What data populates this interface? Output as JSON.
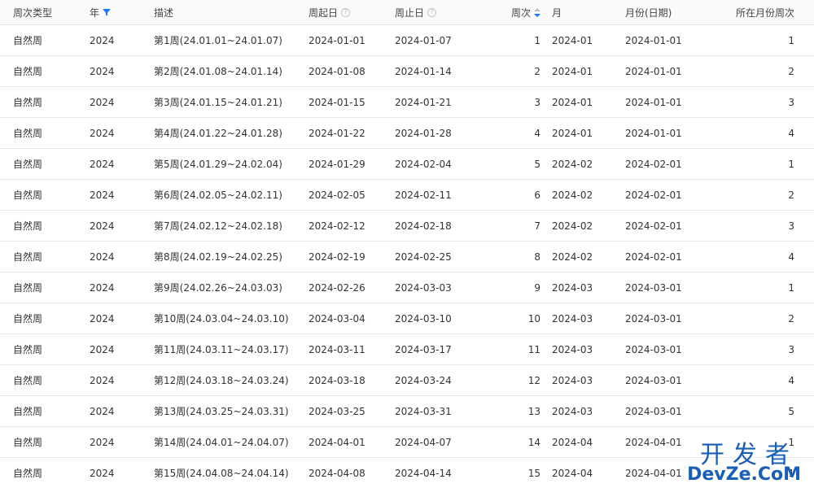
{
  "table": {
    "columns": {
      "week_type": "周次类型",
      "year": "年",
      "description": "描述",
      "start_date": "周起日",
      "end_date": "周止日",
      "week_no": "周次",
      "month": "月",
      "month_date": "月份(日期)",
      "week_in_month": "所在月份周次"
    },
    "rows": [
      {
        "week_type": "自然周",
        "year": "2024",
        "description": "第1周(24.01.01~24.01.07)",
        "start_date": "2024-01-01",
        "end_date": "2024-01-07",
        "week_no": "1",
        "month": "2024-01",
        "month_date": "2024-01-01",
        "week_in_month": "1"
      },
      {
        "week_type": "自然周",
        "year": "2024",
        "description": "第2周(24.01.08~24.01.14)",
        "start_date": "2024-01-08",
        "end_date": "2024-01-14",
        "week_no": "2",
        "month": "2024-01",
        "month_date": "2024-01-01",
        "week_in_month": "2"
      },
      {
        "week_type": "自然周",
        "year": "2024",
        "description": "第3周(24.01.15~24.01.21)",
        "start_date": "2024-01-15",
        "end_date": "2024-01-21",
        "week_no": "3",
        "month": "2024-01",
        "month_date": "2024-01-01",
        "week_in_month": "3"
      },
      {
        "week_type": "自然周",
        "year": "2024",
        "description": "第4周(24.01.22~24.01.28)",
        "start_date": "2024-01-22",
        "end_date": "2024-01-28",
        "week_no": "4",
        "month": "2024-01",
        "month_date": "2024-01-01",
        "week_in_month": "4"
      },
      {
        "week_type": "自然周",
        "year": "2024",
        "description": "第5周(24.01.29~24.02.04)",
        "start_date": "2024-01-29",
        "end_date": "2024-02-04",
        "week_no": "5",
        "month": "2024-02",
        "month_date": "2024-02-01",
        "week_in_month": "1"
      },
      {
        "week_type": "自然周",
        "year": "2024",
        "description": "第6周(24.02.05~24.02.11)",
        "start_date": "2024-02-05",
        "end_date": "2024-02-11",
        "week_no": "6",
        "month": "2024-02",
        "month_date": "2024-02-01",
        "week_in_month": "2"
      },
      {
        "week_type": "自然周",
        "year": "2024",
        "description": "第7周(24.02.12~24.02.18)",
        "start_date": "2024-02-12",
        "end_date": "2024-02-18",
        "week_no": "7",
        "month": "2024-02",
        "month_date": "2024-02-01",
        "week_in_month": "3"
      },
      {
        "week_type": "自然周",
        "year": "2024",
        "description": "第8周(24.02.19~24.02.25)",
        "start_date": "2024-02-19",
        "end_date": "2024-02-25",
        "week_no": "8",
        "month": "2024-02",
        "month_date": "2024-02-01",
        "week_in_month": "4"
      },
      {
        "week_type": "自然周",
        "year": "2024",
        "description": "第9周(24.02.26~24.03.03)",
        "start_date": "2024-02-26",
        "end_date": "2024-03-03",
        "week_no": "9",
        "month": "2024-03",
        "month_date": "2024-03-01",
        "week_in_month": "1"
      },
      {
        "week_type": "自然周",
        "year": "2024",
        "description": "第10周(24.03.04~24.03.10)",
        "start_date": "2024-03-04",
        "end_date": "2024-03-10",
        "week_no": "10",
        "month": "2024-03",
        "month_date": "2024-03-01",
        "week_in_month": "2"
      },
      {
        "week_type": "自然周",
        "year": "2024",
        "description": "第11周(24.03.11~24.03.17)",
        "start_date": "2024-03-11",
        "end_date": "2024-03-17",
        "week_no": "11",
        "month": "2024-03",
        "month_date": "2024-03-01",
        "week_in_month": "3"
      },
      {
        "week_type": "自然周",
        "year": "2024",
        "description": "第12周(24.03.18~24.03.24)",
        "start_date": "2024-03-18",
        "end_date": "2024-03-24",
        "week_no": "12",
        "month": "2024-03",
        "month_date": "2024-03-01",
        "week_in_month": "4"
      },
      {
        "week_type": "自然周",
        "year": "2024",
        "description": "第13周(24.03.25~24.03.31)",
        "start_date": "2024-03-25",
        "end_date": "2024-03-31",
        "week_no": "13",
        "month": "2024-03",
        "month_date": "2024-03-01",
        "week_in_month": "5"
      },
      {
        "week_type": "自然周",
        "year": "2024",
        "description": "第14周(24.04.01~24.04.07)",
        "start_date": "2024-04-01",
        "end_date": "2024-04-07",
        "week_no": "14",
        "month": "2024-04",
        "month_date": "2024-04-01",
        "week_in_month": "1"
      },
      {
        "week_type": "自然周",
        "year": "2024",
        "description": "第15周(24.04.08~24.04.14)",
        "start_date": "2024-04-08",
        "end_date": "2024-04-14",
        "week_no": "15",
        "month": "2024-04",
        "month_date": "2024-04-01",
        "week_in_month": "1"
      }
    ]
  },
  "icons": {
    "year_filter": "filter-icon",
    "start_help": "help-icon",
    "end_help": "help-icon",
    "week_sort": "sort-icon"
  },
  "colors": {
    "filter_active": "#1677ff",
    "sort_inactive": "#bfbfbf"
  },
  "watermark": {
    "title": "开发者",
    "subtitle": "DevZe.CoM"
  }
}
